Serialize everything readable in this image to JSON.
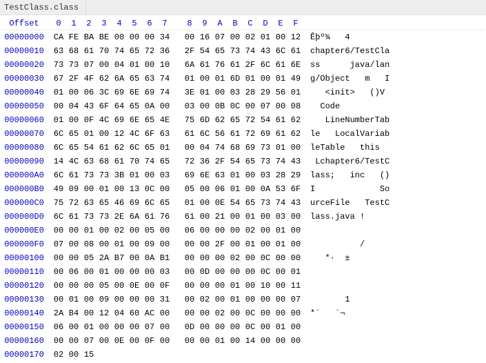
{
  "tab": {
    "title": "TestClass.class"
  },
  "header": {
    "offset_label": "Offset",
    "cols": [
      "0",
      "1",
      "2",
      "3",
      "4",
      "5",
      "6",
      "7",
      "8",
      "9",
      "A",
      "B",
      "C",
      "D",
      "E",
      "F"
    ]
  },
  "rows": [
    {
      "offset": "00000000",
      "hex": [
        "CA",
        "FE",
        "BA",
        "BE",
        "00",
        "00",
        "00",
        "34",
        "00",
        "16",
        "07",
        "00",
        "02",
        "01",
        "00",
        "12"
      ],
      "ascii": "Êþº¾   4      "
    },
    {
      "offset": "00000010",
      "hex": [
        "63",
        "68",
        "61",
        "70",
        "74",
        "65",
        "72",
        "36",
        "2F",
        "54",
        "65",
        "73",
        "74",
        "43",
        "6C",
        "61"
      ],
      "ascii": "chapter6/TestCla"
    },
    {
      "offset": "00000020",
      "hex": [
        "73",
        "73",
        "07",
        "00",
        "04",
        "01",
        "00",
        "10",
        "6A",
        "61",
        "76",
        "61",
        "2F",
        "6C",
        "61",
        "6E"
      ],
      "ascii": "ss      java/lan"
    },
    {
      "offset": "00000030",
      "hex": [
        "67",
        "2F",
        "4F",
        "62",
        "6A",
        "65",
        "63",
        "74",
        "01",
        "00",
        "01",
        "6D",
        "01",
        "00",
        "01",
        "49"
      ],
      "ascii": "g/Object   m   I"
    },
    {
      "offset": "00000040",
      "hex": [
        "01",
        "00",
        "06",
        "3C",
        "69",
        "6E",
        "69",
        "74",
        "3E",
        "01",
        "00",
        "03",
        "28",
        "29",
        "56",
        "01"
      ],
      "ascii": "   <init>   ()V "
    },
    {
      "offset": "00000050",
      "hex": [
        "00",
        "04",
        "43",
        "6F",
        "64",
        "65",
        "0A",
        "00",
        "03",
        "00",
        "0B",
        "0C",
        "00",
        "07",
        "00",
        "08"
      ],
      "ascii": "  Code          "
    },
    {
      "offset": "00000060",
      "hex": [
        "01",
        "00",
        "0F",
        "4C",
        "69",
        "6E",
        "65",
        "4E",
        "75",
        "6D",
        "62",
        "65",
        "72",
        "54",
        "61",
        "62"
      ],
      "ascii": "   LineNumberTab"
    },
    {
      "offset": "00000070",
      "hex": [
        "6C",
        "65",
        "01",
        "00",
        "12",
        "4C",
        "6F",
        "63",
        "61",
        "6C",
        "56",
        "61",
        "72",
        "69",
        "61",
        "62"
      ],
      "ascii": "le   LocalVariab"
    },
    {
      "offset": "00000080",
      "hex": [
        "6C",
        "65",
        "54",
        "61",
        "62",
        "6C",
        "65",
        "01",
        "00",
        "04",
        "74",
        "68",
        "69",
        "73",
        "01",
        "00"
      ],
      "ascii": "leTable   this  "
    },
    {
      "offset": "00000090",
      "hex": [
        "14",
        "4C",
        "63",
        "68",
        "61",
        "70",
        "74",
        "65",
        "72",
        "36",
        "2F",
        "54",
        "65",
        "73",
        "74",
        "43"
      ],
      "ascii": " Lchapter6/TestC"
    },
    {
      "offset": "000000A0",
      "hex": [
        "6C",
        "61",
        "73",
        "73",
        "3B",
        "01",
        "00",
        "03",
        "69",
        "6E",
        "63",
        "01",
        "00",
        "03",
        "28",
        "29"
      ],
      "ascii": "lass;   inc   ()"
    },
    {
      "offset": "000000B0",
      "hex": [
        "49",
        "09",
        "00",
        "01",
        "00",
        "13",
        "0C",
        "00",
        "05",
        "00",
        "06",
        "01",
        "00",
        "0A",
        "53",
        "6F"
      ],
      "ascii": "I             So"
    },
    {
      "offset": "000000C0",
      "hex": [
        "75",
        "72",
        "63",
        "65",
        "46",
        "69",
        "6C",
        "65",
        "01",
        "00",
        "0E",
        "54",
        "65",
        "73",
        "74",
        "43"
      ],
      "ascii": "urceFile   TestC"
    },
    {
      "offset": "000000D0",
      "hex": [
        "6C",
        "61",
        "73",
        "73",
        "2E",
        "6A",
        "61",
        "76",
        "61",
        "00",
        "21",
        "00",
        "01",
        "00",
        "03",
        "00"
      ],
      "ascii": "lass.java !     "
    },
    {
      "offset": "000000E0",
      "hex": [
        "00",
        "00",
        "01",
        "00",
        "02",
        "00",
        "05",
        "00",
        "06",
        "00",
        "00",
        "00",
        "02",
        "00",
        "01",
        "00"
      ],
      "ascii": "                "
    },
    {
      "offset": "000000F0",
      "hex": [
        "07",
        "00",
        "08",
        "00",
        "01",
        "00",
        "09",
        "00",
        "00",
        "00",
        "2F",
        "00",
        "01",
        "00",
        "01",
        "00"
      ],
      "ascii": "          /     "
    },
    {
      "offset": "00000100",
      "hex": [
        "00",
        "00",
        "05",
        "2A",
        "B7",
        "00",
        "0A",
        "B1",
        "00",
        "00",
        "00",
        "02",
        "00",
        "0C",
        "00",
        "00"
      ],
      "ascii": "   *·  ±        "
    },
    {
      "offset": "00000110",
      "hex": [
        "00",
        "06",
        "00",
        "01",
        "00",
        "00",
        "00",
        "03",
        "00",
        "0D",
        "00",
        "00",
        "00",
        "0C",
        "00",
        "01"
      ],
      "ascii": "                "
    },
    {
      "offset": "00000120",
      "hex": [
        "00",
        "00",
        "00",
        "05",
        "00",
        "0E",
        "00",
        "0F",
        "00",
        "00",
        "00",
        "01",
        "00",
        "10",
        "00",
        "11"
      ],
      "ascii": "                "
    },
    {
      "offset": "00000130",
      "hex": [
        "00",
        "01",
        "00",
        "09",
        "00",
        "00",
        "00",
        "31",
        "00",
        "02",
        "00",
        "01",
        "00",
        "00",
        "00",
        "07"
      ],
      "ascii": "       1        "
    },
    {
      "offset": "00000140",
      "hex": [
        "2A",
        "B4",
        "00",
        "12",
        "04",
        "60",
        "AC",
        "00",
        "00",
        "00",
        "02",
        "00",
        "0C",
        "00",
        "00",
        "00"
      ],
      "ascii": "*´   `¬         "
    },
    {
      "offset": "00000150",
      "hex": [
        "06",
        "00",
        "01",
        "00",
        "00",
        "00",
        "07",
        "00",
        "0D",
        "00",
        "00",
        "00",
        "0C",
        "00",
        "01",
        "00"
      ],
      "ascii": "                "
    },
    {
      "offset": "00000160",
      "hex": [
        "00",
        "00",
        "07",
        "00",
        "0E",
        "00",
        "0F",
        "00",
        "00",
        "00",
        "01",
        "00",
        "14",
        "00",
        "00",
        "00"
      ],
      "ascii": "                "
    },
    {
      "offset": "00000170",
      "hex": [
        "02",
        "00",
        "15",
        "",
        "",
        "",
        "",
        "",
        "",
        "",
        "",
        "",
        "",
        "",
        "",
        ""
      ],
      "ascii": ""
    }
  ]
}
